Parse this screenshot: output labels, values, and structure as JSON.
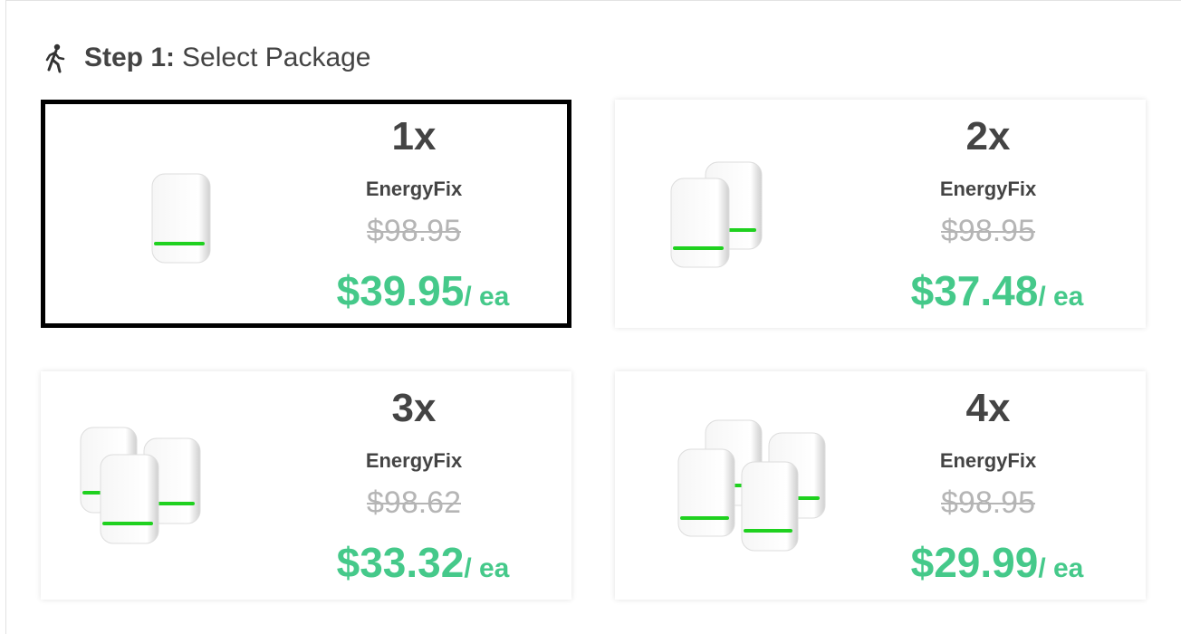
{
  "header": {
    "step_label": "Step 1:",
    "step_text": "Select Package",
    "icon": "walking-person-icon"
  },
  "packages": [
    {
      "qty": "1x",
      "name": "EnergyFix",
      "old_price": "$98.95",
      "price": "$39.95",
      "unit": "/ ea",
      "selected": true,
      "units_shown": 1
    },
    {
      "qty": "2x",
      "name": "EnergyFix",
      "old_price": "$98.95",
      "price": "$37.48",
      "unit": "/ ea",
      "selected": false,
      "units_shown": 2
    },
    {
      "qty": "3x",
      "name": "EnergyFix",
      "old_price": "$98.62",
      "price": "$33.32",
      "unit": "/ ea",
      "selected": false,
      "units_shown": 3
    },
    {
      "qty": "4x",
      "name": "EnergyFix",
      "old_price": "$98.95",
      "price": "$29.99",
      "unit": "/ ea",
      "selected": false,
      "units_shown": 4
    }
  ],
  "colors": {
    "price_green": "#45c98a",
    "old_price_gray": "#b5b5b5",
    "text_dark": "#444444",
    "led_green": "#1fd11f"
  }
}
